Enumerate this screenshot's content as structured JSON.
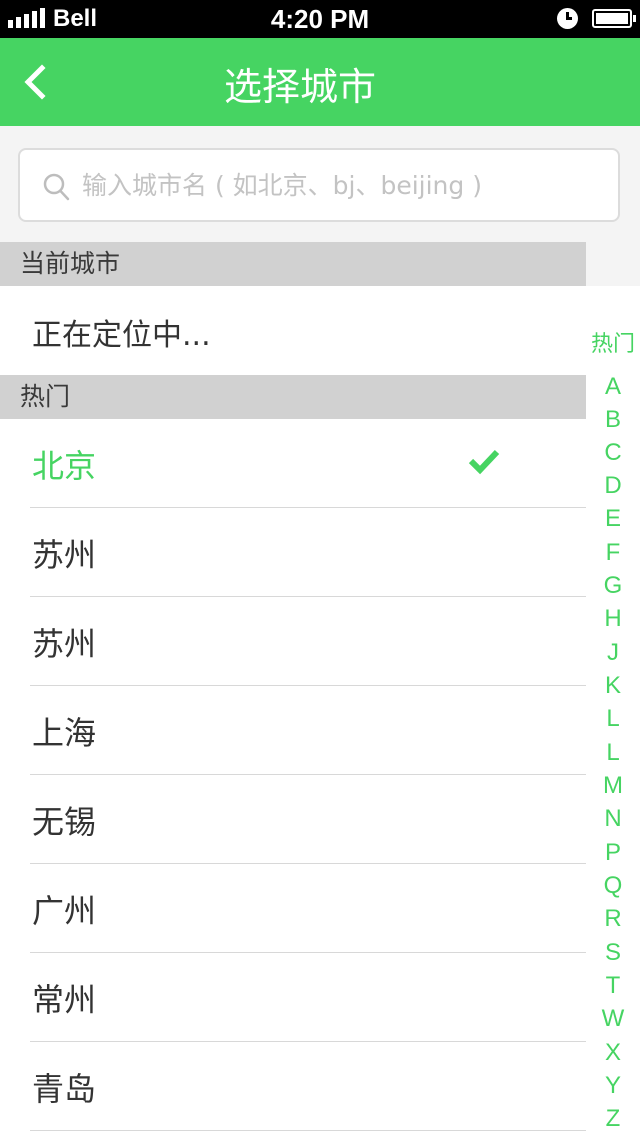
{
  "status_bar": {
    "carrier": "Bell",
    "time": "4:20 PM",
    "icons": [
      "signal-icon",
      "alarm-icon",
      "battery-icon"
    ]
  },
  "nav": {
    "title": "选择城市",
    "back_icon": "chevron-left-icon"
  },
  "search": {
    "placeholder": "输入城市名 ( 如北京、bj、beijing )",
    "value": ""
  },
  "sections": {
    "current_header": "当前城市",
    "current_text": "正在定位中...",
    "hot_header": "热门"
  },
  "cities": [
    {
      "name": "北京",
      "selected": true
    },
    {
      "name": "苏州",
      "selected": false
    },
    {
      "name": "苏州",
      "selected": false
    },
    {
      "name": "上海",
      "selected": false
    },
    {
      "name": "无锡",
      "selected": false
    },
    {
      "name": "广州",
      "selected": false
    },
    {
      "name": "常州",
      "selected": false
    },
    {
      "name": "青岛",
      "selected": false
    }
  ],
  "index": [
    "热门",
    "A",
    "B",
    "C",
    "D",
    "E",
    "F",
    "G",
    "H",
    "J",
    "K",
    "L",
    "L",
    "M",
    "N",
    "P",
    "Q",
    "R",
    "S",
    "T",
    "W",
    "X",
    "Y",
    "Z"
  ],
  "colors": {
    "accent": "#46d462",
    "section_bg": "#d1d1d1",
    "page_bg": "#f4f4f4"
  }
}
